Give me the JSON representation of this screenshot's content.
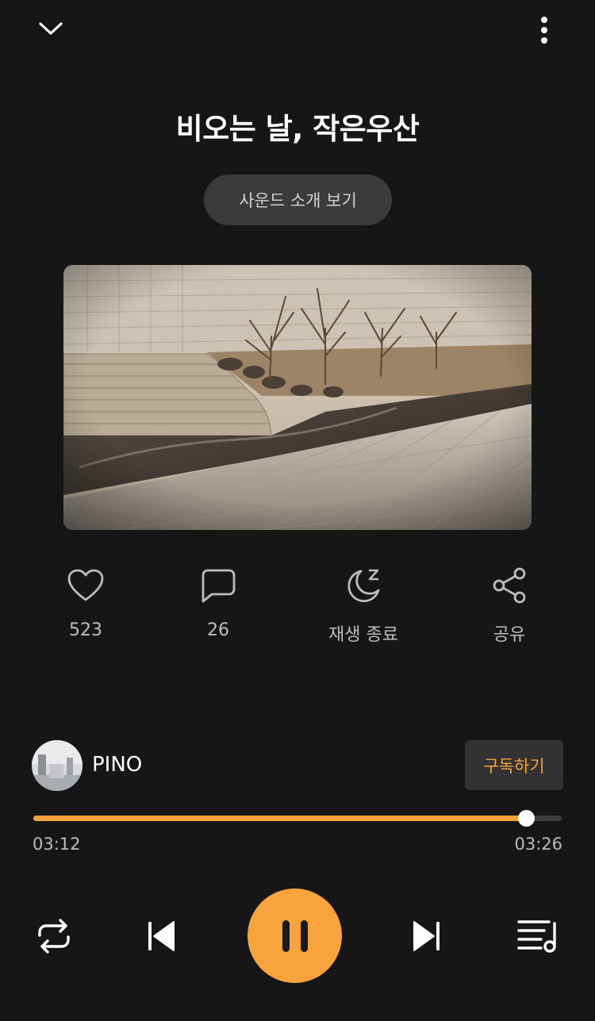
{
  "header": {
    "collapse_icon": "chevron-down-icon",
    "more_icon": "more-vertical-icon"
  },
  "track": {
    "title": "비오는 날, 작은우산",
    "intro_button": "사운드 소개 보기",
    "artwork": "rainy riverside stream with stone steps and bare trees"
  },
  "actions": [
    {
      "icon": "heart-icon",
      "label": "523"
    },
    {
      "icon": "comment-icon",
      "label": "26"
    },
    {
      "icon": "sleep-timer-icon",
      "label": "재생 종료"
    },
    {
      "icon": "share-icon",
      "label": "공유"
    }
  ],
  "artist": {
    "name": "PINO",
    "subscribe_label": "구독하기"
  },
  "progress": {
    "current": "03:12",
    "total": "03:26",
    "fraction": 0.932
  },
  "controls": {
    "repeat_icon": "repeat-icon",
    "prev_icon": "skip-previous-icon",
    "play_icon": "pause-icon",
    "next_icon": "skip-next-icon",
    "queue_icon": "playlist-icon"
  },
  "colors": {
    "background": "#161616",
    "accent": "#f7a23c",
    "subscribe_text": "#f5a33d"
  }
}
